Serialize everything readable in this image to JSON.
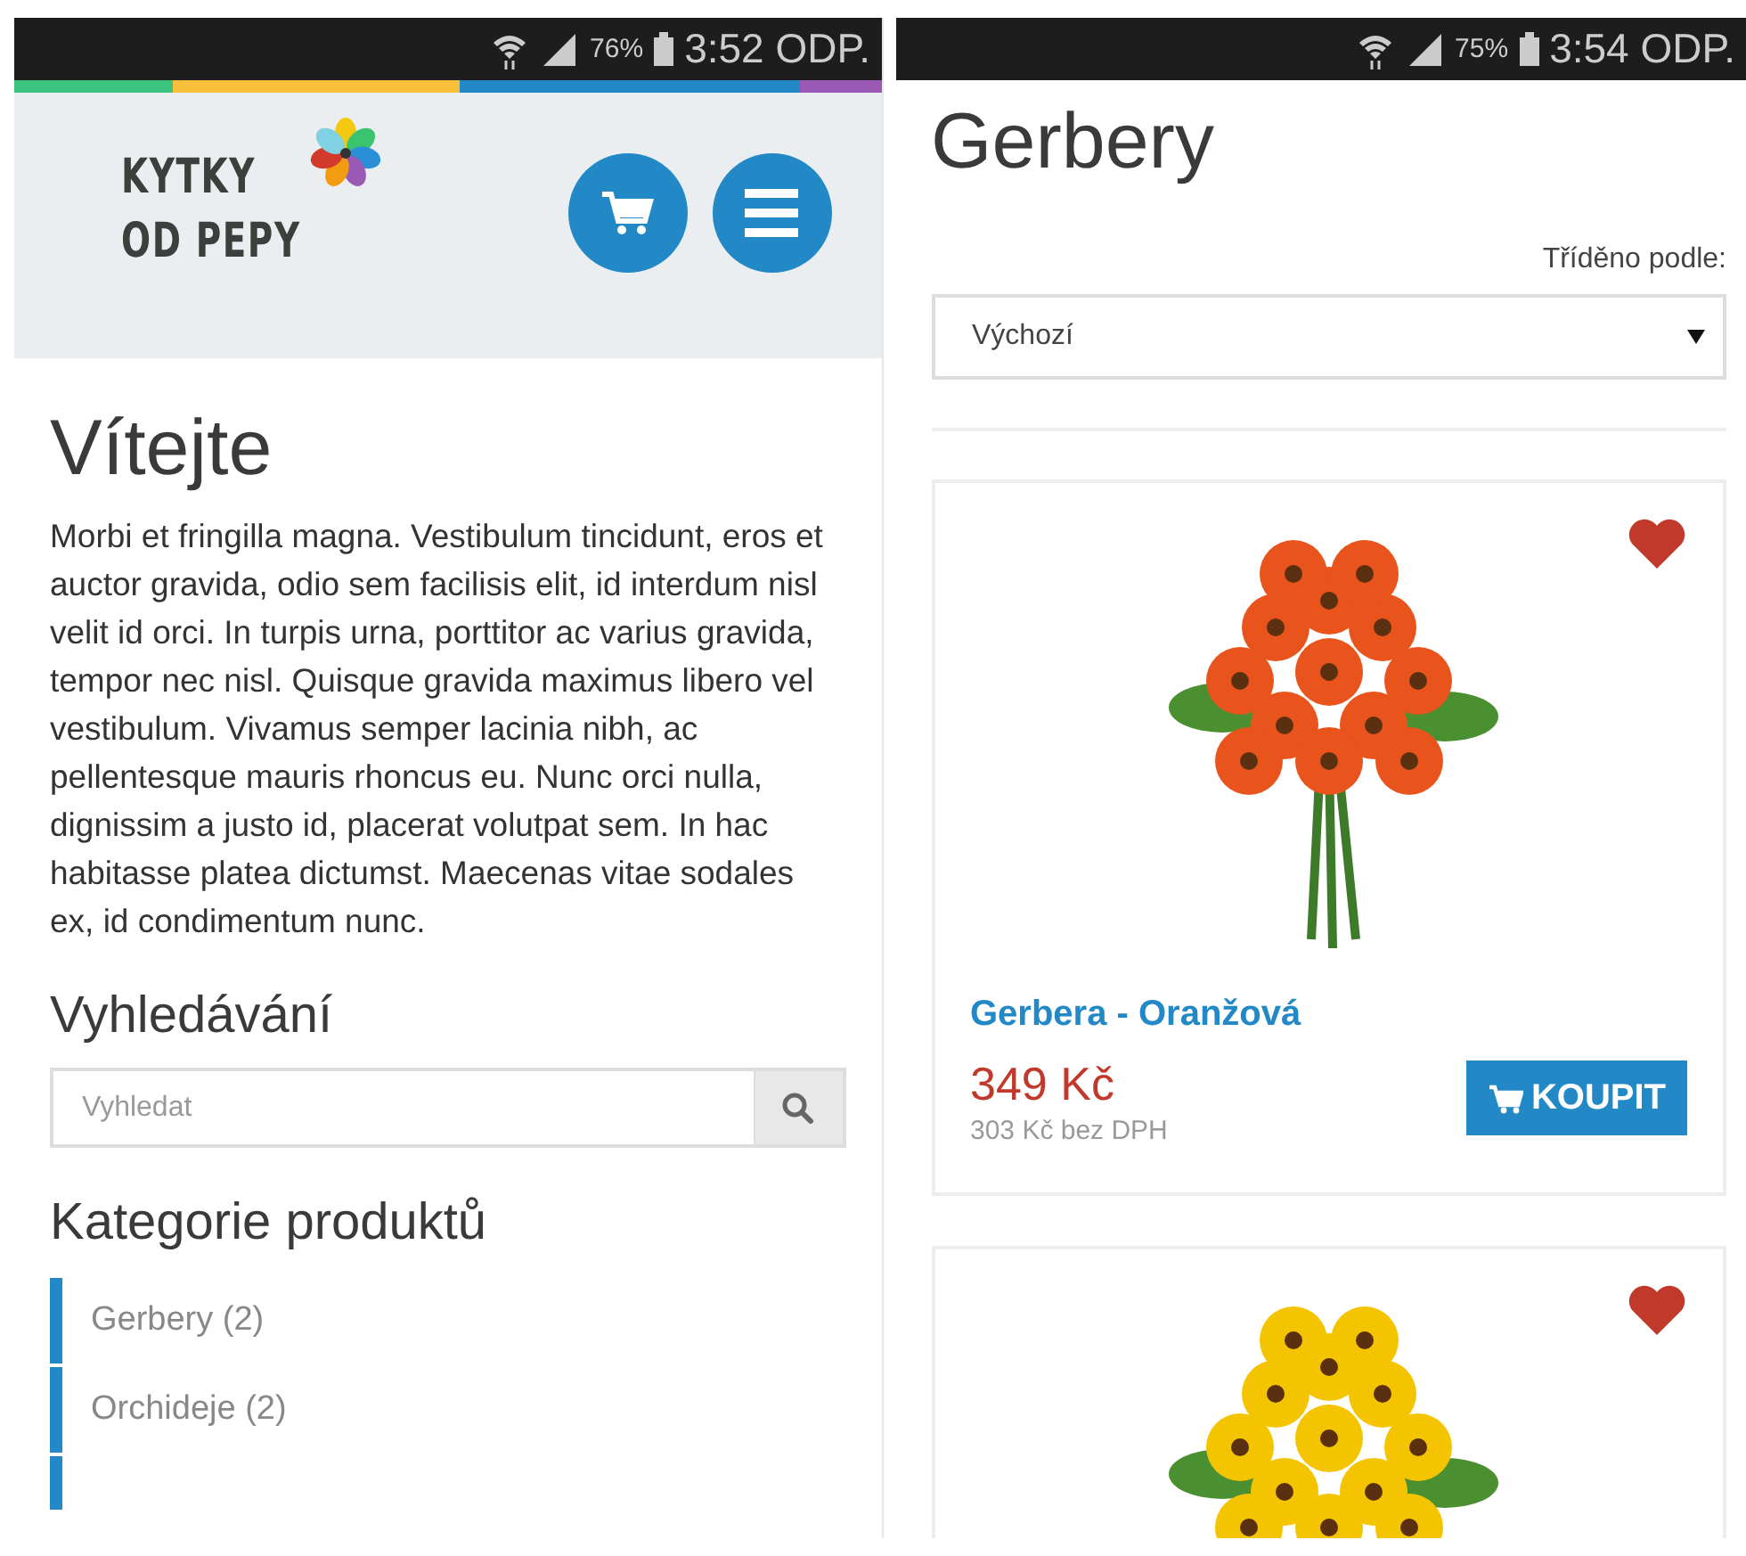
{
  "left_screen": {
    "status_bar": {
      "battery": "76%",
      "time": "3:52 ODP."
    },
    "logo": {
      "line1": "KYTKY",
      "line2": "OD PEPY"
    },
    "welcome": {
      "title": "Vítejte",
      "text": "Morbi et fringilla magna. Vestibulum tincidunt, eros et auctor gravida, odio sem facilisis elit, id interdum nisl velit id orci. In turpis urna, porttitor ac varius gravida, tempor nec nisl. Quisque gravida maximus libero vel vestibulum. Vivamus semper lacinia nibh, ac pellentesque mauris rhoncus eu. Nunc orci nulla, dignissim a justo id, placerat volutpat sem. In hac habitasse platea dictumst. Maecenas vitae sodales ex, id condimentum nunc."
    },
    "search": {
      "title": "Vyhledávání",
      "placeholder": "Vyhledat"
    },
    "categories": {
      "title": "Kategorie produktů",
      "items": [
        {
          "label": "Gerbery (2)"
        },
        {
          "label": "Orchideje (2)"
        }
      ]
    }
  },
  "right_screen": {
    "status_bar": {
      "battery": "75%",
      "time": "3:54 ODP."
    },
    "title": "Gerbery",
    "sort": {
      "label": "Tříděno podle:",
      "value": "Výchozí"
    },
    "products": [
      {
        "color": "#e8541c",
        "name": "Gerbera - Oranžová",
        "price": "349 Kč",
        "price_net": "303 Kč bez DPH",
        "button": "KOUPIT"
      },
      {
        "color": "#f5c400"
      }
    ]
  }
}
